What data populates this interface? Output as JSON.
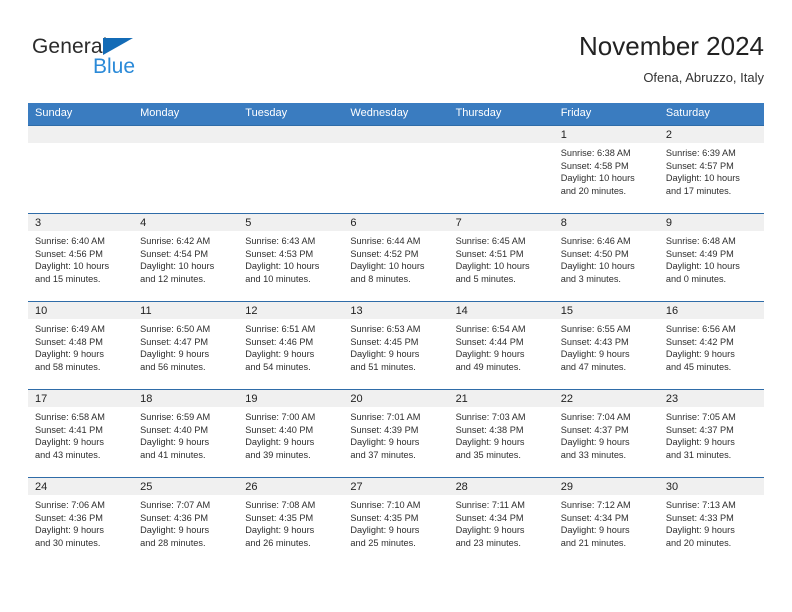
{
  "brand": {
    "name_part1": "General",
    "name_part2": "Blue",
    "triangle_color": "#136bb6",
    "blue_color": "#2b8ad8"
  },
  "header": {
    "month_title": "November 2024",
    "location": "Ofena, Abruzzo, Italy"
  },
  "theme": {
    "header_bg": "#3a7cc0",
    "row_border": "#2f6ca8",
    "daynum_bg": "#f0f0f0"
  },
  "weekdays": [
    "Sunday",
    "Monday",
    "Tuesday",
    "Wednesday",
    "Thursday",
    "Friday",
    "Saturday"
  ],
  "weeks": [
    [
      {
        "day": "",
        "lines": []
      },
      {
        "day": "",
        "lines": []
      },
      {
        "day": "",
        "lines": []
      },
      {
        "day": "",
        "lines": []
      },
      {
        "day": "",
        "lines": []
      },
      {
        "day": "1",
        "lines": [
          "Sunrise: 6:38 AM",
          "Sunset: 4:58 PM",
          "Daylight: 10 hours",
          "and 20 minutes."
        ]
      },
      {
        "day": "2",
        "lines": [
          "Sunrise: 6:39 AM",
          "Sunset: 4:57 PM",
          "Daylight: 10 hours",
          "and 17 minutes."
        ]
      }
    ],
    [
      {
        "day": "3",
        "lines": [
          "Sunrise: 6:40 AM",
          "Sunset: 4:56 PM",
          "Daylight: 10 hours",
          "and 15 minutes."
        ]
      },
      {
        "day": "4",
        "lines": [
          "Sunrise: 6:42 AM",
          "Sunset: 4:54 PM",
          "Daylight: 10 hours",
          "and 12 minutes."
        ]
      },
      {
        "day": "5",
        "lines": [
          "Sunrise: 6:43 AM",
          "Sunset: 4:53 PM",
          "Daylight: 10 hours",
          "and 10 minutes."
        ]
      },
      {
        "day": "6",
        "lines": [
          "Sunrise: 6:44 AM",
          "Sunset: 4:52 PM",
          "Daylight: 10 hours",
          "and 8 minutes."
        ]
      },
      {
        "day": "7",
        "lines": [
          "Sunrise: 6:45 AM",
          "Sunset: 4:51 PM",
          "Daylight: 10 hours",
          "and 5 minutes."
        ]
      },
      {
        "day": "8",
        "lines": [
          "Sunrise: 6:46 AM",
          "Sunset: 4:50 PM",
          "Daylight: 10 hours",
          "and 3 minutes."
        ]
      },
      {
        "day": "9",
        "lines": [
          "Sunrise: 6:48 AM",
          "Sunset: 4:49 PM",
          "Daylight: 10 hours",
          "and 0 minutes."
        ]
      }
    ],
    [
      {
        "day": "10",
        "lines": [
          "Sunrise: 6:49 AM",
          "Sunset: 4:48 PM",
          "Daylight: 9 hours",
          "and 58 minutes."
        ]
      },
      {
        "day": "11",
        "lines": [
          "Sunrise: 6:50 AM",
          "Sunset: 4:47 PM",
          "Daylight: 9 hours",
          "and 56 minutes."
        ]
      },
      {
        "day": "12",
        "lines": [
          "Sunrise: 6:51 AM",
          "Sunset: 4:46 PM",
          "Daylight: 9 hours",
          "and 54 minutes."
        ]
      },
      {
        "day": "13",
        "lines": [
          "Sunrise: 6:53 AM",
          "Sunset: 4:45 PM",
          "Daylight: 9 hours",
          "and 51 minutes."
        ]
      },
      {
        "day": "14",
        "lines": [
          "Sunrise: 6:54 AM",
          "Sunset: 4:44 PM",
          "Daylight: 9 hours",
          "and 49 minutes."
        ]
      },
      {
        "day": "15",
        "lines": [
          "Sunrise: 6:55 AM",
          "Sunset: 4:43 PM",
          "Daylight: 9 hours",
          "and 47 minutes."
        ]
      },
      {
        "day": "16",
        "lines": [
          "Sunrise: 6:56 AM",
          "Sunset: 4:42 PM",
          "Daylight: 9 hours",
          "and 45 minutes."
        ]
      }
    ],
    [
      {
        "day": "17",
        "lines": [
          "Sunrise: 6:58 AM",
          "Sunset: 4:41 PM",
          "Daylight: 9 hours",
          "and 43 minutes."
        ]
      },
      {
        "day": "18",
        "lines": [
          "Sunrise: 6:59 AM",
          "Sunset: 4:40 PM",
          "Daylight: 9 hours",
          "and 41 minutes."
        ]
      },
      {
        "day": "19",
        "lines": [
          "Sunrise: 7:00 AM",
          "Sunset: 4:40 PM",
          "Daylight: 9 hours",
          "and 39 minutes."
        ]
      },
      {
        "day": "20",
        "lines": [
          "Sunrise: 7:01 AM",
          "Sunset: 4:39 PM",
          "Daylight: 9 hours",
          "and 37 minutes."
        ]
      },
      {
        "day": "21",
        "lines": [
          "Sunrise: 7:03 AM",
          "Sunset: 4:38 PM",
          "Daylight: 9 hours",
          "and 35 minutes."
        ]
      },
      {
        "day": "22",
        "lines": [
          "Sunrise: 7:04 AM",
          "Sunset: 4:37 PM",
          "Daylight: 9 hours",
          "and 33 minutes."
        ]
      },
      {
        "day": "23",
        "lines": [
          "Sunrise: 7:05 AM",
          "Sunset: 4:37 PM",
          "Daylight: 9 hours",
          "and 31 minutes."
        ]
      }
    ],
    [
      {
        "day": "24",
        "lines": [
          "Sunrise: 7:06 AM",
          "Sunset: 4:36 PM",
          "Daylight: 9 hours",
          "and 30 minutes."
        ]
      },
      {
        "day": "25",
        "lines": [
          "Sunrise: 7:07 AM",
          "Sunset: 4:36 PM",
          "Daylight: 9 hours",
          "and 28 minutes."
        ]
      },
      {
        "day": "26",
        "lines": [
          "Sunrise: 7:08 AM",
          "Sunset: 4:35 PM",
          "Daylight: 9 hours",
          "and 26 minutes."
        ]
      },
      {
        "day": "27",
        "lines": [
          "Sunrise: 7:10 AM",
          "Sunset: 4:35 PM",
          "Daylight: 9 hours",
          "and 25 minutes."
        ]
      },
      {
        "day": "28",
        "lines": [
          "Sunrise: 7:11 AM",
          "Sunset: 4:34 PM",
          "Daylight: 9 hours",
          "and 23 minutes."
        ]
      },
      {
        "day": "29",
        "lines": [
          "Sunrise: 7:12 AM",
          "Sunset: 4:34 PM",
          "Daylight: 9 hours",
          "and 21 minutes."
        ]
      },
      {
        "day": "30",
        "lines": [
          "Sunrise: 7:13 AM",
          "Sunset: 4:33 PM",
          "Daylight: 9 hours",
          "and 20 minutes."
        ]
      }
    ]
  ]
}
